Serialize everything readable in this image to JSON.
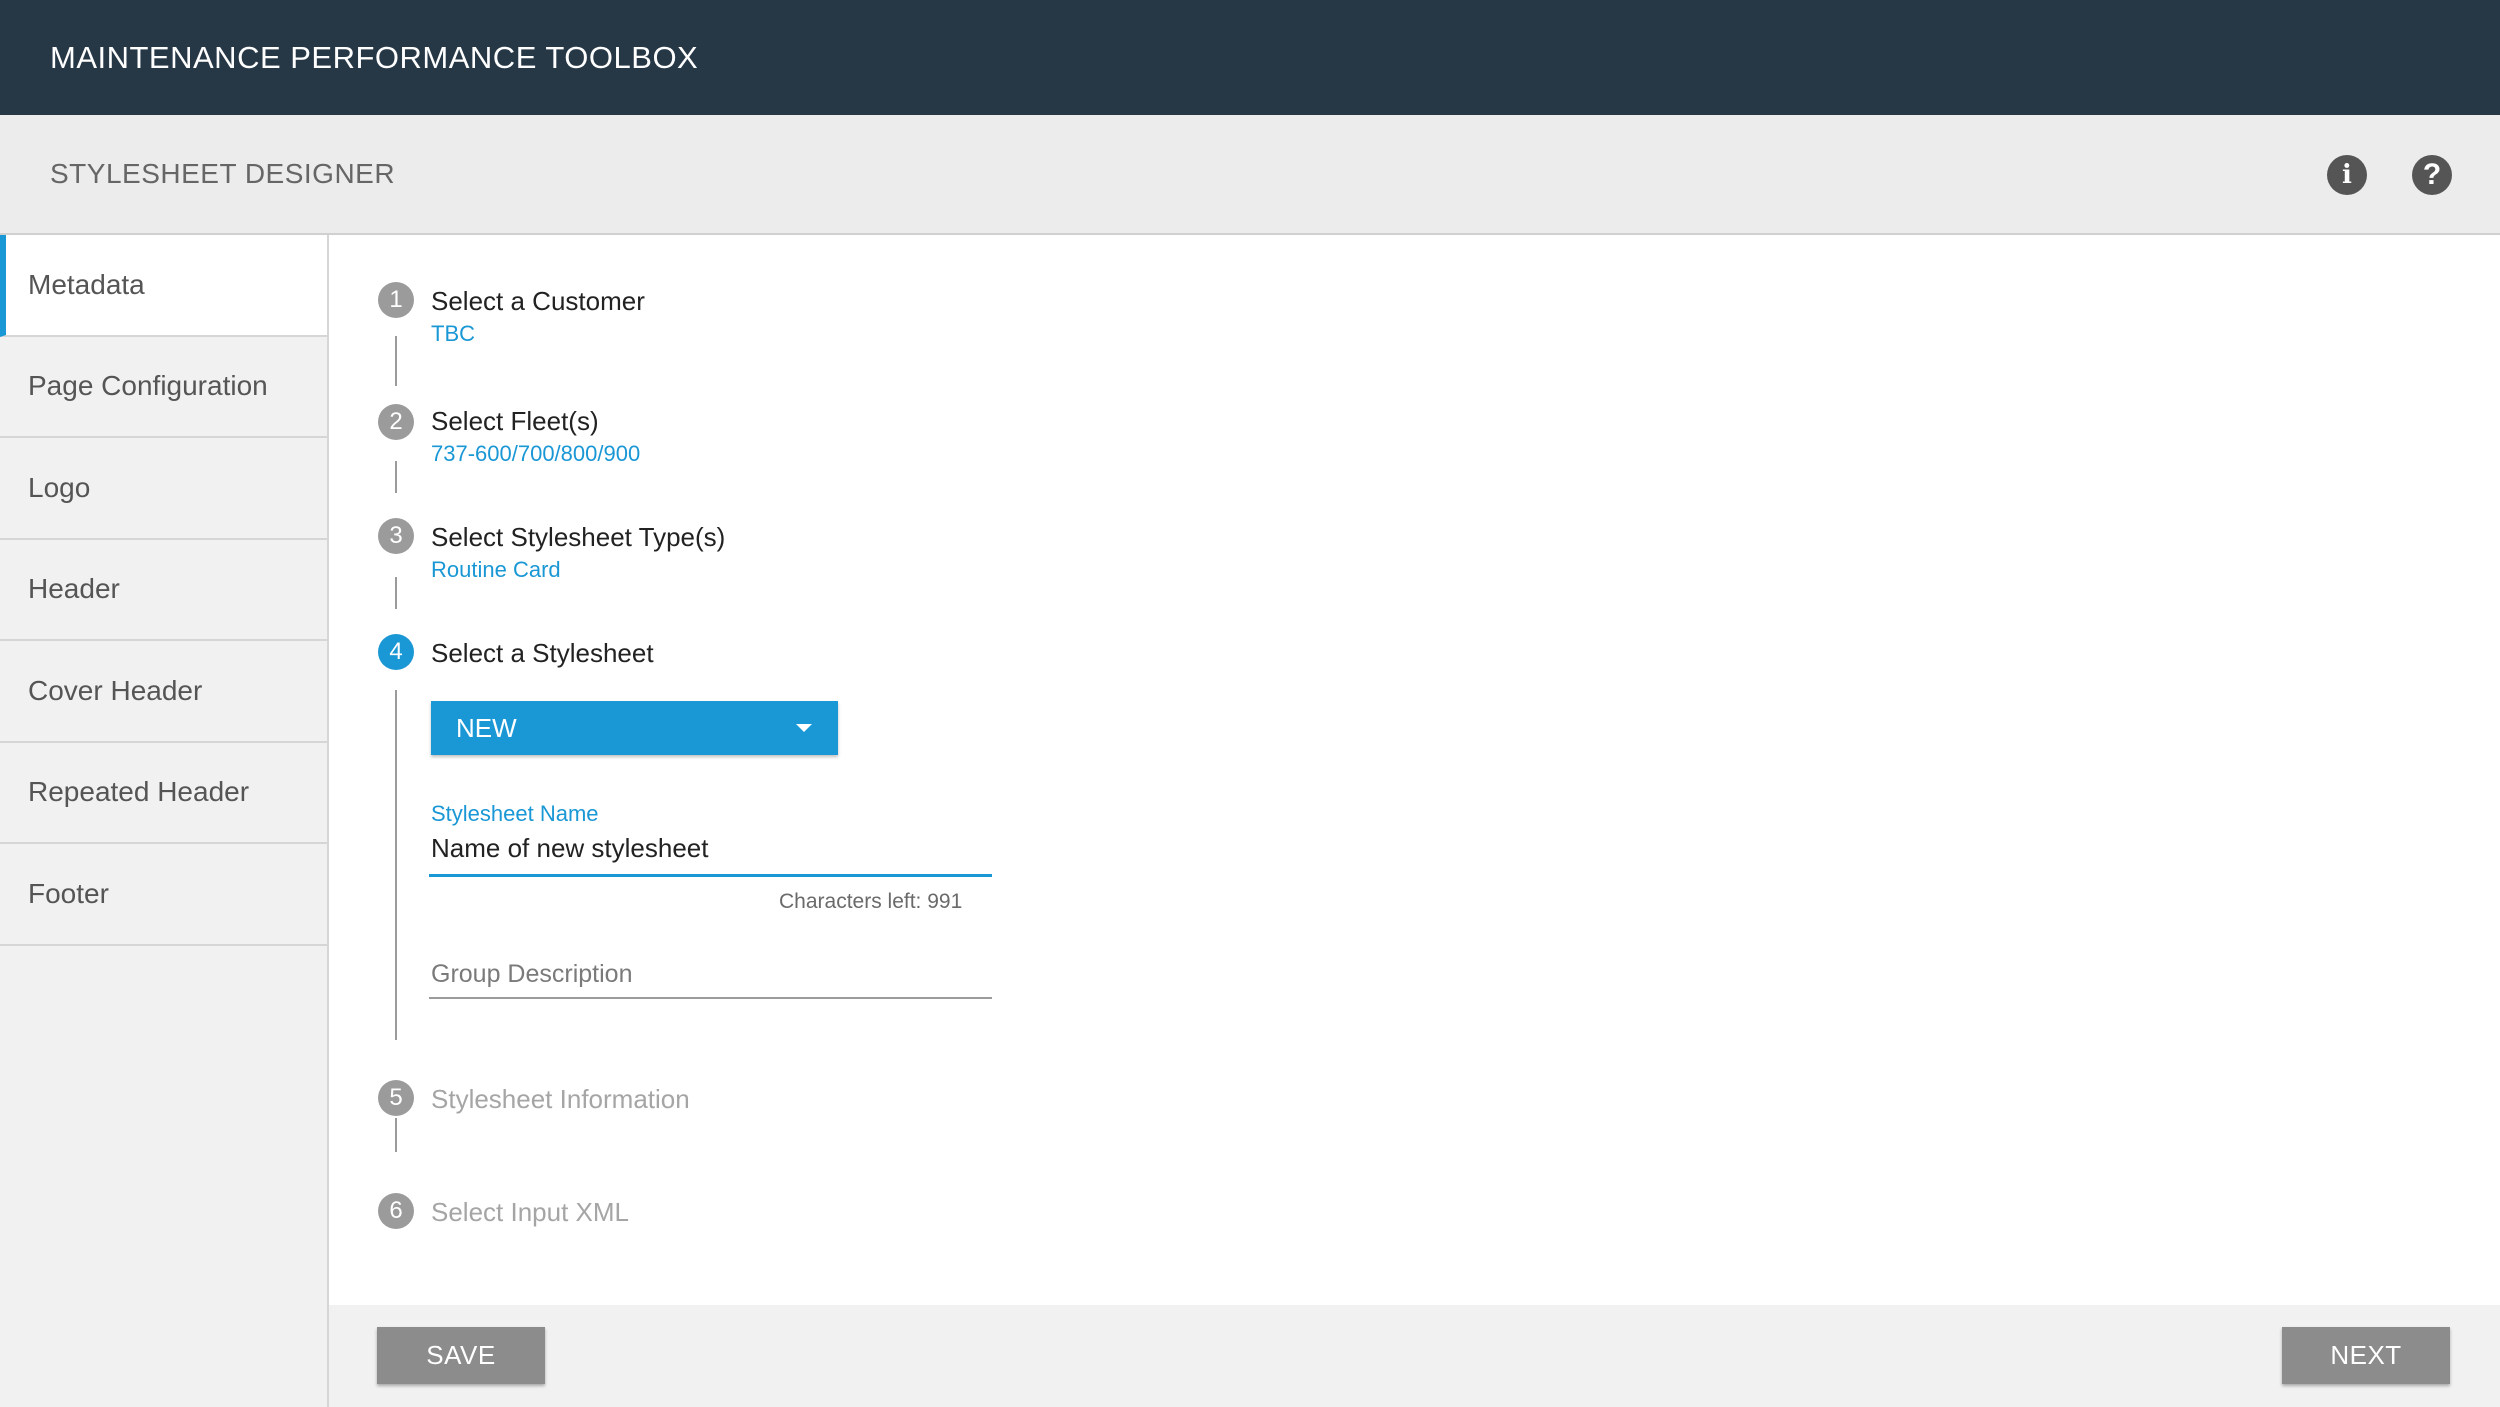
{
  "app": {
    "title": "MAINTENANCE PERFORMANCE TOOLBOX"
  },
  "subheader": {
    "title": "STYLESHEET DESIGNER"
  },
  "icons": {
    "info": "info-icon",
    "help": "help-icon"
  },
  "icon_glyphs": {
    "info": "i",
    "help": "?"
  },
  "colors": {
    "accent": "#1a97d5",
    "app_bar": "#263746",
    "button_gray": "#8c8c8c"
  },
  "sidebar": {
    "items": [
      {
        "label": "Metadata",
        "active": true
      },
      {
        "label": "Page Configuration"
      },
      {
        "label": "Logo"
      },
      {
        "label": "Header"
      },
      {
        "label": "Cover Header"
      },
      {
        "label": "Repeated Header"
      },
      {
        "label": "Footer"
      }
    ]
  },
  "steps": [
    {
      "number": "1",
      "title": "Select a Customer",
      "value": "TBC"
    },
    {
      "number": "2",
      "title": "Select Fleet(s)",
      "value": "737-600/700/800/900"
    },
    {
      "number": "3",
      "title": "Select Stylesheet Type(s)",
      "value": "Routine Card"
    },
    {
      "number": "4",
      "title": "Select a Stylesheet"
    },
    {
      "number": "5",
      "title": "Stylesheet Information"
    },
    {
      "number": "6",
      "title": "Select Input XML"
    }
  ],
  "stylesheet_form": {
    "dropdown_value": "NEW",
    "name_label": "Stylesheet Name",
    "name_value": "Name of new stylesheet",
    "chars_left_label": "Characters left:",
    "chars_left_value": "991",
    "group_description_placeholder": "Group Description"
  },
  "footer": {
    "save_label": "SAVE",
    "next_label": "NEXT"
  }
}
